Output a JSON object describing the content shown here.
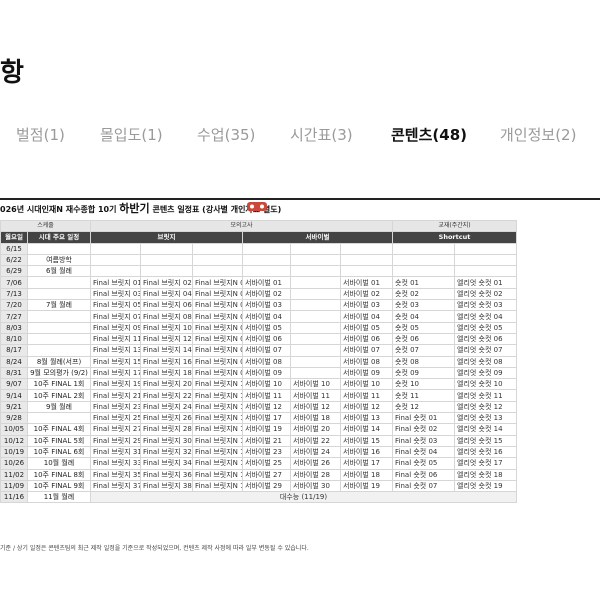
{
  "header": {
    "title": "항"
  },
  "tabs": [
    {
      "label": "벌점(1)",
      "active": false
    },
    {
      "label": "몰입도(1)",
      "active": false
    },
    {
      "label": "수업(35)",
      "active": false
    },
    {
      "label": "시간표(3)",
      "active": false
    },
    {
      "label": "콘텐츠(48)",
      "active": true
    },
    {
      "label": "개인정보(2)",
      "active": false
    }
  ],
  "sheet": {
    "title_prefix": "026년 시대인재N 재수종합 10기",
    "title_big": "하반기",
    "title_suffix": "콘텐츠 일정표 (강사별 개인자료 별도)",
    "group_headers": {
      "schedule": "스케줄",
      "mock": "모의고사",
      "edu": "교재(주간지)"
    },
    "col_headers": {
      "month": "월요일",
      "main": "시대 주요 일정",
      "brilliant": "브릿지",
      "survival": "서바이벌",
      "shortcut": "Shortcut"
    },
    "rows": [
      {
        "date": "6/15",
        "sched": "",
        "b1": "",
        "b2": "",
        "b3": "",
        "s1": "",
        "s2": "",
        "s3": "",
        "c1": "",
        "c2": ""
      },
      {
        "date": "6/22",
        "sched": "여름방학",
        "b1": "",
        "b2": "",
        "b3": "",
        "s1": "",
        "s2": "",
        "s3": "",
        "c1": "",
        "c2": ""
      },
      {
        "date": "6/29",
        "sched": "6월 월례",
        "b1": "",
        "b2": "",
        "b3": "",
        "s1": "",
        "s2": "",
        "s3": "",
        "c1": "",
        "c2": ""
      },
      {
        "date": "7/06",
        "sched": "",
        "b1": "Final 브릿지 01",
        "b2": "Final 브릿지 02",
        "b3": "Final 브릿지N 01",
        "s1": "서바이벌 01",
        "s2": "",
        "s3": "서바이벌 01",
        "c1": "숏컷 01",
        "c2": "엘리엇 숏컷 01"
      },
      {
        "date": "7/13",
        "sched": "",
        "b1": "Final 브릿지 03",
        "b2": "Final 브릿지 04",
        "b3": "Final 브릿지N 02",
        "s1": "서바이벌 02",
        "s2": "",
        "s3": "서바이벌 02",
        "c1": "숏컷 02",
        "c2": "엘리엇 숏컷 02"
      },
      {
        "date": "7/20",
        "sched": "7월 월례",
        "b1": "Final 브릿지 05",
        "b2": "Final 브릿지 06",
        "b3": "Final 브릿지N 03",
        "s1": "서바이벌 03",
        "s2": "",
        "s3": "서바이벌 03",
        "c1": "숏컷 03",
        "c2": "엘리엇 숏컷 03"
      },
      {
        "date": "7/27",
        "sched": "",
        "b1": "Final 브릿지 07",
        "b2": "Final 브릿지 08",
        "b3": "Final 브릿지N 04",
        "s1": "서바이벌 04",
        "s2": "",
        "s3": "서바이벌 04",
        "c1": "숏컷 04",
        "c2": "엘리엇 숏컷 04"
      },
      {
        "date": "8/03",
        "sched": "",
        "b1": "Final 브릿지 09",
        "b2": "Final 브릿지 10",
        "b3": "Final 브릿지N 05",
        "s1": "서바이벌 05",
        "s2": "",
        "s3": "서바이벌 05",
        "c1": "숏컷 05",
        "c2": "엘리엇 숏컷 05"
      },
      {
        "date": "8/10",
        "sched": "",
        "b1": "Final 브릿지 11",
        "b2": "Final 브릿지 12",
        "b3": "Final 브릿지N 06",
        "s1": "서바이벌 06",
        "s2": "",
        "s3": "서바이벌 06",
        "c1": "숏컷 06",
        "c2": "엘리엇 숏컷 06"
      },
      {
        "date": "8/17",
        "sched": "",
        "b1": "Final 브릿지 13",
        "b2": "Final 브릿지 14",
        "b3": "Final 브릿지N 07",
        "s1": "서바이벌 07",
        "s2": "",
        "s3": "서바이벌 07",
        "c1": "숏컷 07",
        "c2": "엘리엇 숏컷 07"
      },
      {
        "date": "8/24",
        "sched": "8월 월례(서프)",
        "b1": "Final 브릿지 15",
        "b2": "Final 브릿지 16",
        "b3": "Final 브릿지N 08",
        "s1": "서바이벌 08",
        "s2": "",
        "s3": "서바이벌 08",
        "c1": "숏컷 08",
        "c2": "엘리엇 숏컷 08"
      },
      {
        "date": "8/31",
        "sched": "9월 모의평가 (9/2)",
        "b1": "Final 브릿지 17",
        "b2": "Final 브릿지 18",
        "b3": "Final 브릿지N 09",
        "s1": "서바이벌 09",
        "s2": "",
        "s3": "서바이벌 09",
        "c1": "숏컷 09",
        "c2": "엘리엇 숏컷 09"
      },
      {
        "date": "9/07",
        "sched": "10주 FINAL 1회",
        "b1": "Final 브릿지 19",
        "b2": "Final 브릿지 20",
        "b3": "Final 브릿지N 10",
        "s1": "서바이벌 10",
        "s2": "서바이벌 10",
        "s3": "서바이벌 10",
        "c1": "숏컷 10",
        "c2": "엘리엇 숏컷 10"
      },
      {
        "date": "9/14",
        "sched": "10주 FINAL 2회",
        "b1": "Final 브릿지 21",
        "b2": "Final 브릿지 22",
        "b3": "Final 브릿지N 11",
        "s1": "서바이벌 11",
        "s2": "서바이벌 11",
        "s3": "서바이벌 11",
        "c1": "숏컷 11",
        "c2": "엘리엇 숏컷 11"
      },
      {
        "date": "9/21",
        "sched": "9월 월례",
        "b1": "Final 브릿지 23",
        "b2": "Final 브릿지 24",
        "b3": "Final 브릿지N 12",
        "s1": "서바이벌 12",
        "s2": "서바이벌 12",
        "s3": "서바이벌 12",
        "c1": "숏컷 12",
        "c2": "엘리엇 숏컷 12"
      },
      {
        "date": "9/28",
        "sched": "",
        "b1": "Final 브릿지 25",
        "b2": "Final 브릿지 26",
        "b3": "Final 브릿지N 13",
        "s1": "서바이벌 17",
        "s2": "서바이벌 18",
        "s3": "서바이벌 13",
        "c1": "Final 숏컷 01",
        "c2": "엘리엇 숏컷 13"
      },
      {
        "date": "10/05",
        "sched": "10주 FINAL 4회",
        "b1": "Final 브릿지 27",
        "b2": "Final 브릿지 28",
        "b3": "Final 브릿지N 14",
        "s1": "서바이벌 19",
        "s2": "서바이벌 20",
        "s3": "서바이벌 14",
        "c1": "Final 숏컷 02",
        "c2": "엘리엇 숏컷 14"
      },
      {
        "date": "10/12",
        "sched": "10주 FINAL 5회",
        "b1": "Final 브릿지 29",
        "b2": "Final 브릿지 30",
        "b3": "Final 브릿지N 15",
        "s1": "서바이벌 21",
        "s2": "서바이벌 22",
        "s3": "서바이벌 15",
        "c1": "Final 숏컷 03",
        "c2": "엘리엇 숏컷 15"
      },
      {
        "date": "10/19",
        "sched": "10주 FINAL 6회",
        "b1": "Final 브릿지 31",
        "b2": "Final 브릿지 32",
        "b3": "Final 브릿지N 16",
        "s1": "서바이벌 23",
        "s2": "서바이벌 24",
        "s3": "서바이벌 16",
        "c1": "Final 숏컷 04",
        "c2": "엘리엇 숏컷 16"
      },
      {
        "date": "10/26",
        "sched": "10월 월례",
        "b1": "Final 브릿지 33",
        "b2": "Final 브릿지 34",
        "b3": "Final 브릿지N 17",
        "s1": "서바이벌 25",
        "s2": "서바이벌 26",
        "s3": "서바이벌 17",
        "c1": "Final 숏컷 05",
        "c2": "엘리엇 숏컷 17"
      },
      {
        "date": "11/02",
        "sched": "10주 FINAL 8회",
        "b1": "Final 브릿지 35",
        "b2": "Final 브릿지 36",
        "b3": "Final 브릿지N 18",
        "s1": "서바이벌 27",
        "s2": "서바이벌 28",
        "s3": "서바이벌 18",
        "c1": "Final 숏컷 06",
        "c2": "엘리엇 숏컷 18"
      },
      {
        "date": "11/09",
        "sched": "10주 FINAL 9회",
        "b1": "Final 브릿지 37",
        "b2": "Final 브릿지 38",
        "b3": "Final 브릿지N 19",
        "s1": "서바이벌 29",
        "s2": "서바이벌 30",
        "s3": "서바이벌 19",
        "c1": "Final 숏컷 07",
        "c2": "엘리엇 숏컷 19"
      }
    ],
    "final_row": {
      "date": "11/16",
      "sched": "11월 월례",
      "label": "대수능 (11/19)"
    },
    "note": "기준 / 상기 일정은 콘텐츠팀의 최근 제작 일정을 기준으로 작성되었으며, 컨텐츠 제작 사정에 따라 일부 변동될 수 있습니다."
  }
}
